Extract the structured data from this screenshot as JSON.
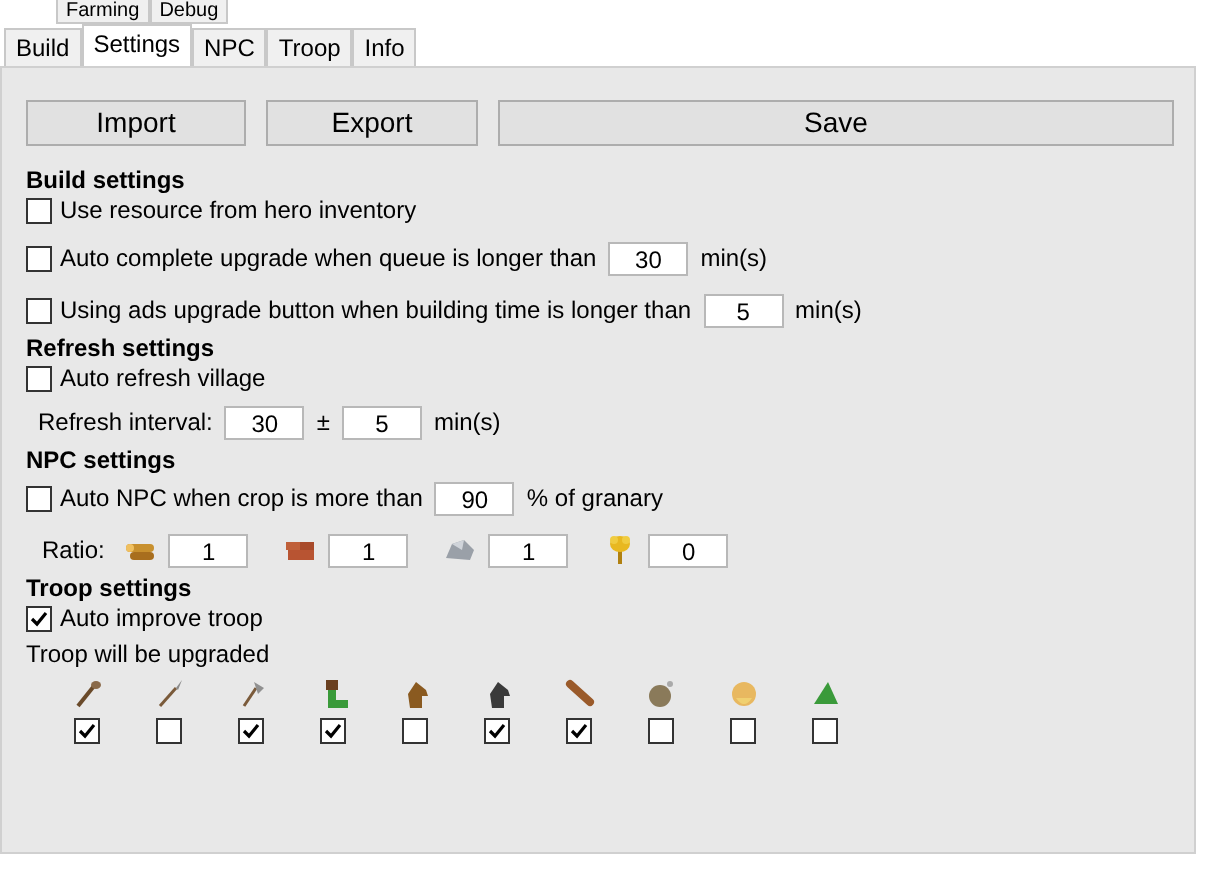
{
  "top_tabs": [
    {
      "label": "Farming",
      "selected": false
    },
    {
      "label": "Debug",
      "selected": false
    }
  ],
  "tabs": [
    {
      "label": "Build",
      "selected": false
    },
    {
      "label": "Settings",
      "selected": true
    },
    {
      "label": "NPC",
      "selected": false
    },
    {
      "label": "Troop",
      "selected": false
    },
    {
      "label": "Info",
      "selected": false
    }
  ],
  "buttons": [
    "Import",
    "Export",
    "Save"
  ],
  "build_settings": {
    "title": "Build settings",
    "options": [
      {
        "label": "Use resource from hero inventory",
        "checked": false
      },
      {
        "label": "Auto complete upgrade when queue is longer than",
        "checked": false,
        "value": "30",
        "unit": "min(s)"
      },
      {
        "label": "Using ads upgrade button when building time is longer than",
        "checked": false,
        "value": "5",
        "unit": "min(s)"
      }
    ]
  },
  "refresh_settings": {
    "title": "Refresh settings",
    "auto_refresh": {
      "label": "Auto refresh village",
      "checked": false
    },
    "interval_label": "Refresh interval:",
    "interval": "30",
    "plus_minus": "±",
    "variance": "5",
    "unit": "min(s)"
  },
  "npc_settings": {
    "title": "NPC settings",
    "auto_npc": {
      "label": "Auto NPC when crop is more than",
      "checked": false,
      "value": "90",
      "unit": "% of granary"
    },
    "ratio_label": "Ratio:",
    "ratios": [
      {
        "kind": "wood",
        "value": "1"
      },
      {
        "kind": "clay",
        "value": "1"
      },
      {
        "kind": "iron",
        "value": "1"
      },
      {
        "kind": "crop",
        "value": "0"
      }
    ]
  },
  "troop_settings": {
    "title": "Troop settings",
    "auto_improve": {
      "label": "Auto improve troop",
      "checked": true
    },
    "upgrade_label": "Troop will be upgraded",
    "troops": [
      {
        "kind": "club",
        "checked": true
      },
      {
        "kind": "spear",
        "checked": false
      },
      {
        "kind": "axe",
        "checked": true
      },
      {
        "kind": "scout",
        "checked": true
      },
      {
        "kind": "horse",
        "checked": false
      },
      {
        "kind": "darkhorse",
        "checked": true
      },
      {
        "kind": "ram",
        "checked": true
      },
      {
        "kind": "catapult",
        "checked": false
      },
      {
        "kind": "chief",
        "checked": false
      },
      {
        "kind": "settler",
        "checked": false
      }
    ]
  }
}
